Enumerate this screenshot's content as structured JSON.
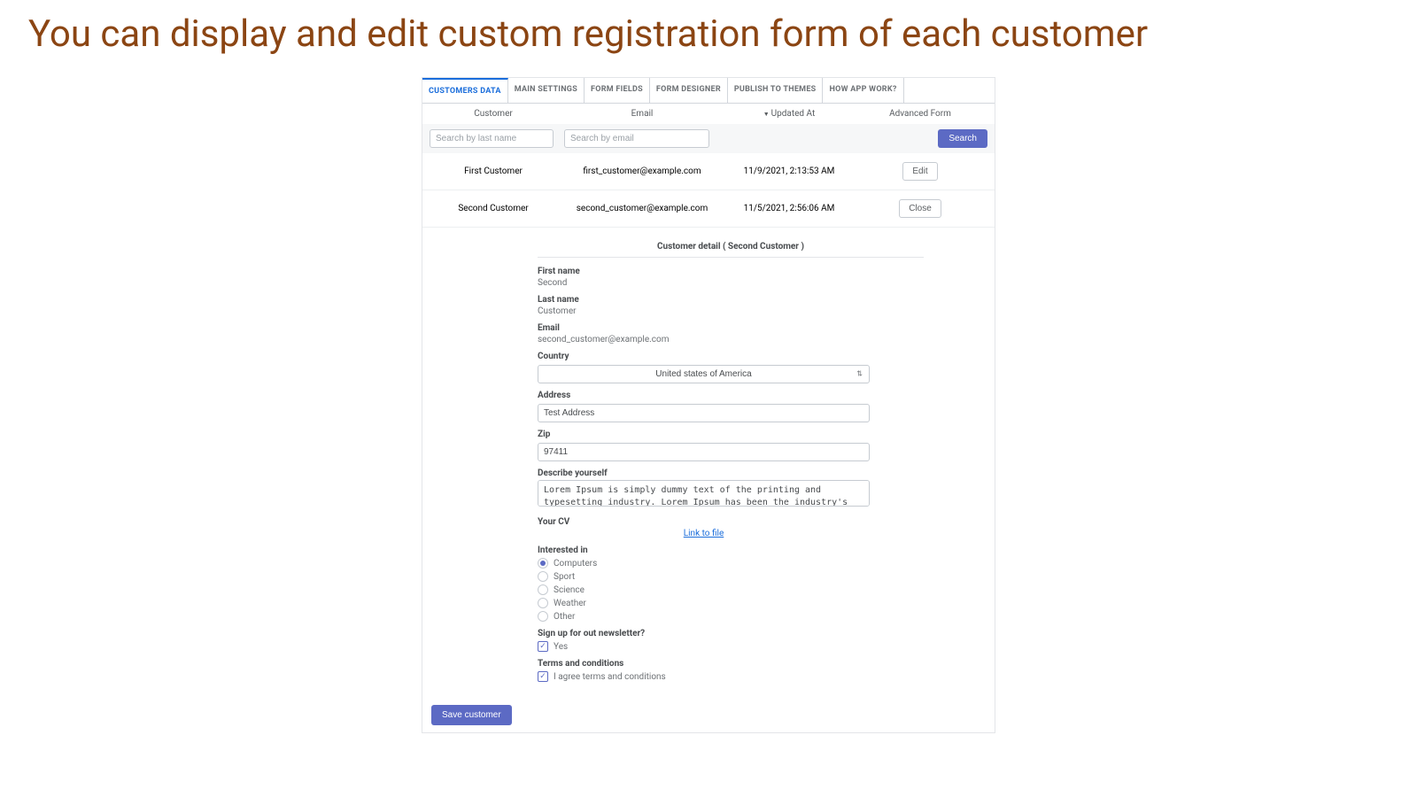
{
  "page_title": "You can display and edit custom registration form of each customer",
  "tabs": [
    {
      "label": "CUSTOMERS DATA",
      "active": true
    },
    {
      "label": "MAIN SETTINGS"
    },
    {
      "label": "FORM FIELDS"
    },
    {
      "label": "FORM DESIGNER"
    },
    {
      "label": "PUBLISH TO THEMES"
    },
    {
      "label": "HOW APP WORK?"
    }
  ],
  "columns": {
    "customer": "Customer",
    "email": "Email",
    "updated": "Updated At",
    "action": "Advanced Form"
  },
  "filters": {
    "name_placeholder": "Search by last name",
    "email_placeholder": "Search by email",
    "search_btn": "Search"
  },
  "rows": [
    {
      "name": "First Customer",
      "email": "first_customer@example.com",
      "updated": "11/9/2021, 2:13:53 AM",
      "action": "Edit"
    },
    {
      "name": "Second Customer",
      "email": "second_customer@example.com",
      "updated": "11/5/2021, 2:56:06 AM",
      "action": "Close"
    }
  ],
  "detail": {
    "title": "Customer detail ( Second Customer )",
    "first_name": {
      "label": "First name",
      "value": "Second"
    },
    "last_name": {
      "label": "Last name",
      "value": "Customer"
    },
    "email": {
      "label": "Email",
      "value": "second_customer@example.com"
    },
    "country": {
      "label": "Country",
      "value": "United states of America"
    },
    "address": {
      "label": "Address",
      "value": "Test Address"
    },
    "zip": {
      "label": "Zip",
      "value": "97411"
    },
    "describe": {
      "label": "Describe yourself",
      "value": "Lorem Ipsum is simply dummy text of the printing and typesetting industry. Lorem Ipsum has been the industry's standard dummy text ever since the 1500s, when an unknown printer took a galley of type and"
    },
    "cv": {
      "label": "Your CV",
      "link_text": "Link to file"
    },
    "interested": {
      "label": "Interested in",
      "options": [
        "Computers",
        "Sport",
        "Science",
        "Weather",
        "Other"
      ],
      "selected": "Computers"
    },
    "newsletter": {
      "label": "Sign up for out newsletter?",
      "option": "Yes",
      "checked": true
    },
    "terms": {
      "label": "Terms and conditions",
      "option": "I agree terms and conditions",
      "checked": true
    },
    "save_btn": "Save customer"
  }
}
